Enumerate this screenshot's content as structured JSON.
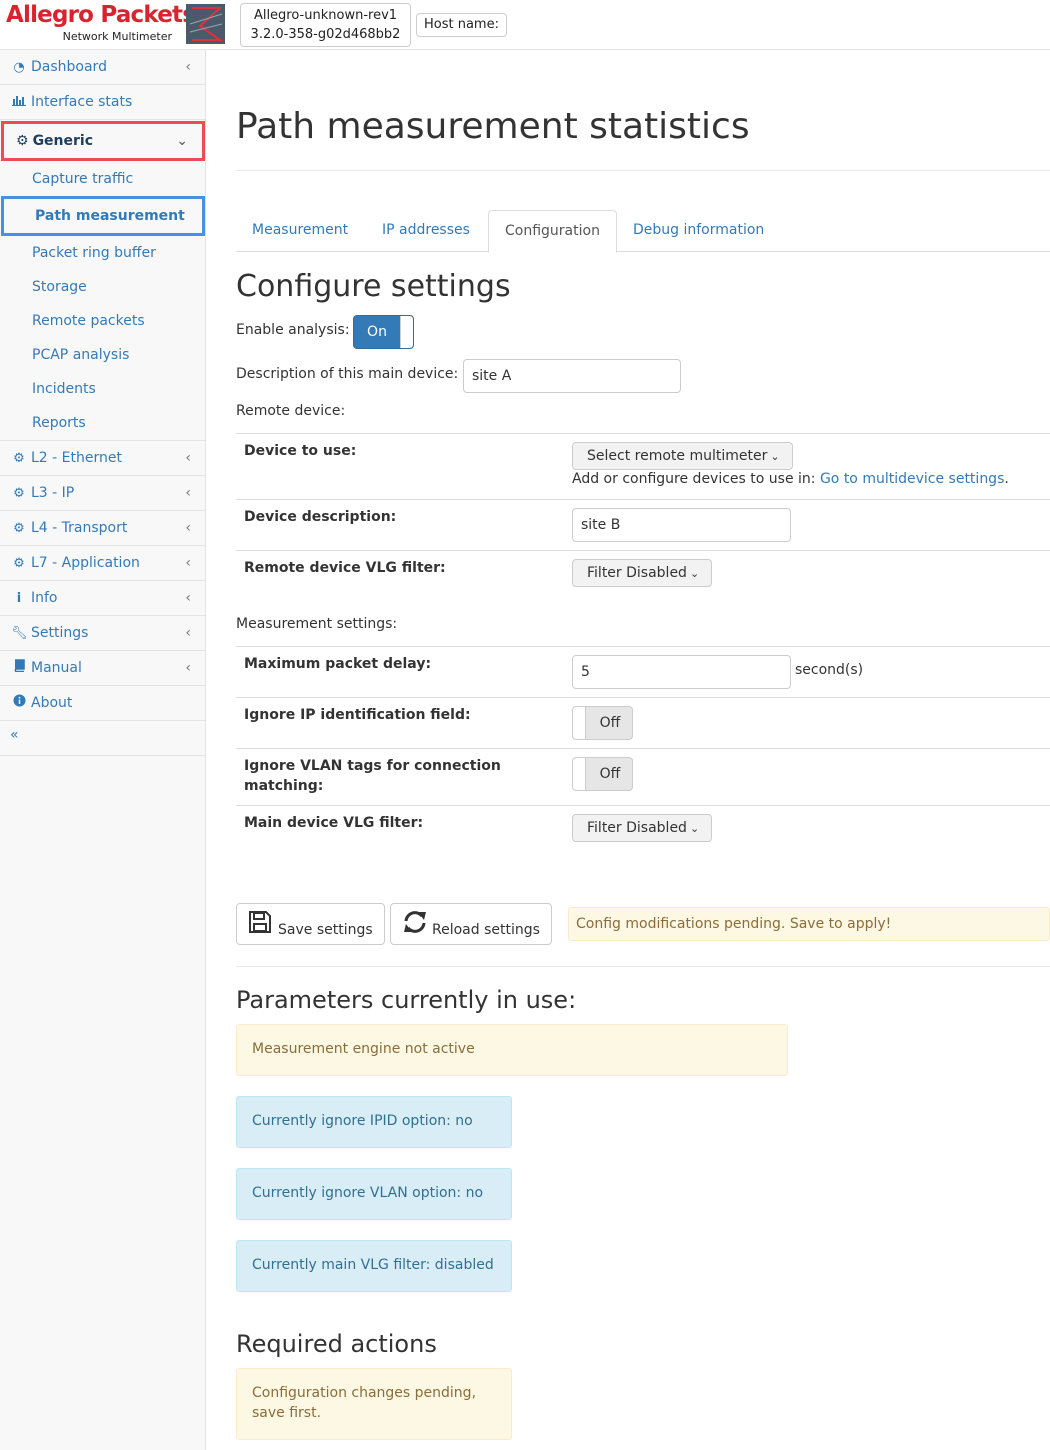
{
  "header": {
    "logo_main": "Allegro Packets",
    "logo_sub": "Network Multimeter",
    "device_name": "Allegro-unknown-rev1",
    "device_version": "3.2.0-358-g02d468bb2",
    "host_label": "Host name:"
  },
  "sidebar": {
    "items": [
      {
        "label": "Dashboard",
        "icon": "dashboard-icon"
      },
      {
        "label": "Interface stats",
        "icon": "bar-chart-icon"
      },
      {
        "label": "Generic",
        "icon": "gear-icon"
      },
      {
        "label": "L2 - Ethernet",
        "icon": "gear-icon"
      },
      {
        "label": "L3 - IP",
        "icon": "gear-icon"
      },
      {
        "label": "L4 - Transport",
        "icon": "gear-icon"
      },
      {
        "label": "L7 - Application",
        "icon": "gear-icon"
      },
      {
        "label": "Info",
        "icon": "info-icon"
      },
      {
        "label": "Settings",
        "icon": "wrench-icon"
      },
      {
        "label": "Manual",
        "icon": "book-icon"
      },
      {
        "label": "About",
        "icon": "info-circle-icon"
      }
    ],
    "generic_sub": [
      "Capture traffic",
      "Path measurement",
      "Packet ring buffer",
      "Storage",
      "Remote packets",
      "PCAP analysis",
      "Incidents",
      "Reports"
    ],
    "collapse_label": "«"
  },
  "page": {
    "title": "Path measurement statistics",
    "tabs": [
      "Measurement",
      "IP addresses",
      "Configuration",
      "Debug information"
    ],
    "active_tab": "Configuration"
  },
  "config": {
    "heading": "Configure settings",
    "enable_label": "Enable analysis:",
    "enable_value": "On",
    "description_label": "Description of this main device:",
    "description_value": "site A",
    "remote_device_label": "Remote device:",
    "device_to_use_label": "Device to use:",
    "device_to_use_value": "Select remote multimeter",
    "device_hint": "Add or configure devices to use in:",
    "device_hint_link": "Go to multidevice settings",
    "device_hint_end": ".",
    "device_description_label": "Device description:",
    "device_description_value": "site B",
    "remote_vlg_label": "Remote device VLG filter:",
    "remote_vlg_value": "Filter Disabled",
    "measurement_settings_label": "Measurement settings:",
    "max_delay_label": "Maximum packet delay:",
    "max_delay_value": "5",
    "max_delay_unit": "second(s)",
    "ignore_ip_label": "Ignore IP identification field:",
    "ignore_ip_value": "Off",
    "ignore_vlan_label_1": "Ignore VLAN tags for connection",
    "ignore_vlan_label_2": "matching:",
    "ignore_vlan_value": "Off",
    "main_vlg_label": "Main device VLG filter:",
    "main_vlg_value": "Filter Disabled",
    "save_label": "Save settings",
    "reload_label": "Reload settings",
    "pending_msg": "Config modifications pending. Save to apply!"
  },
  "params": {
    "heading": "Parameters currently in use:",
    "engine_msg": "Measurement engine not active",
    "ipid_msg": "Currently ignore IPID option: no",
    "vlan_msg": "Currently ignore VLAN option: no",
    "vlg_msg": "Currently main VLG filter: disabled"
  },
  "actions": {
    "heading": "Required actions",
    "msg_line1": "Configuration changes pending,",
    "msg_line2": "save first."
  },
  "colors": {
    "link": "#337ab7",
    "brand_red": "#d9232e",
    "highlight_red": "#ef4a55",
    "highlight_blue": "#4a90e2"
  }
}
